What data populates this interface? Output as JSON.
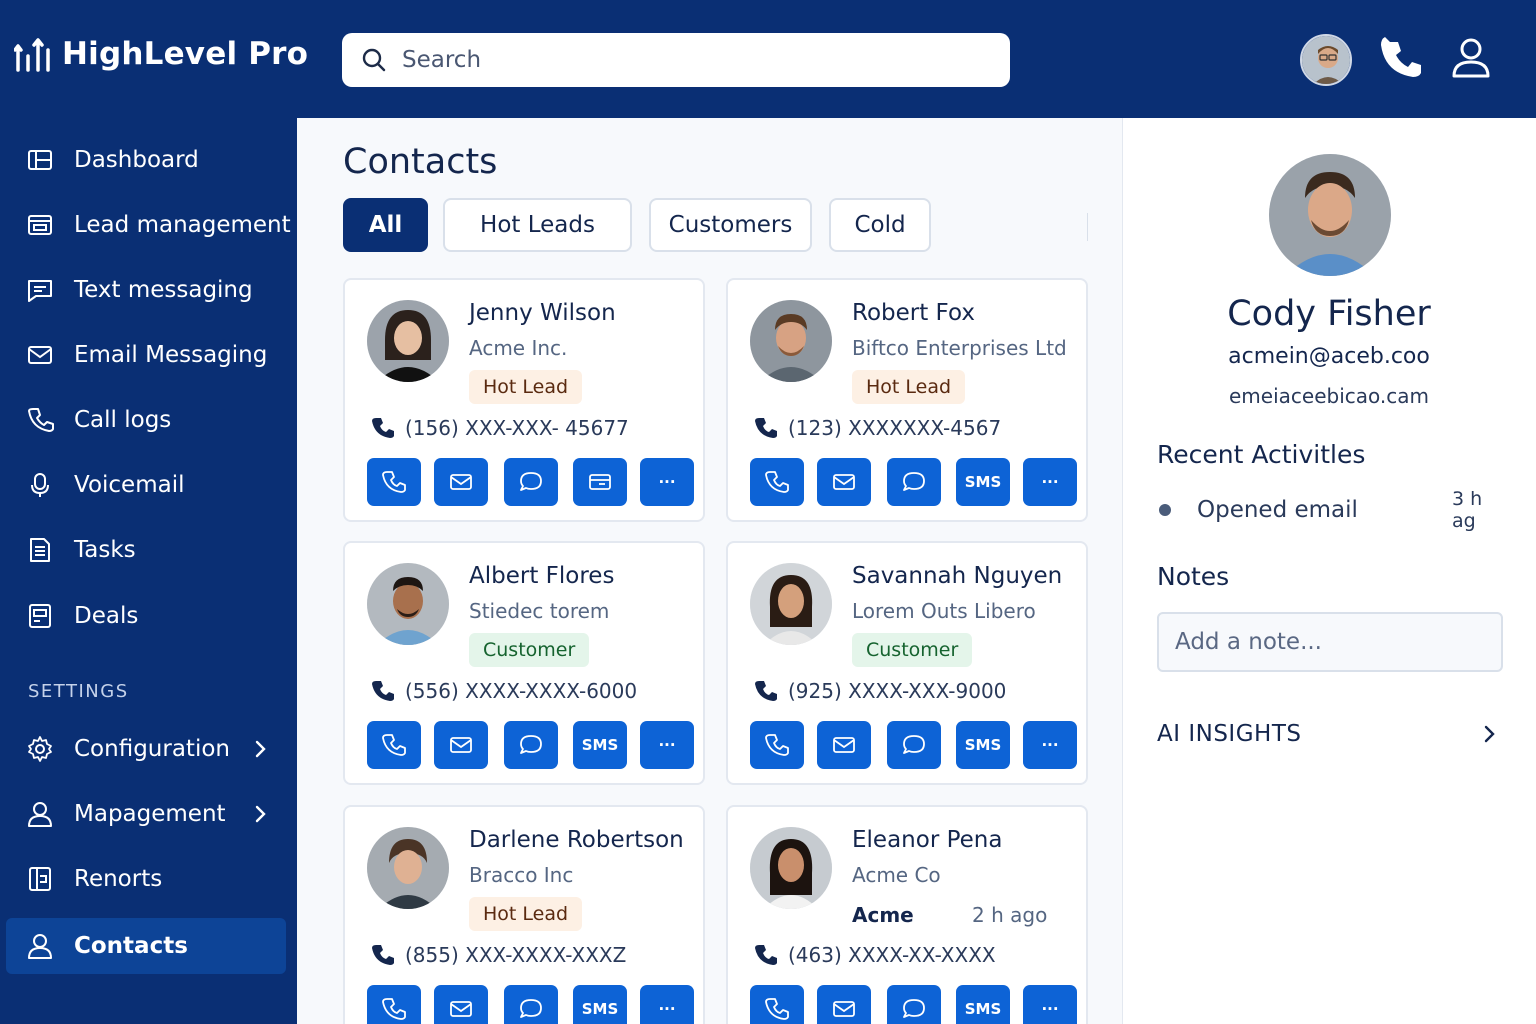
{
  "app": {
    "name": "HighLevel Pro"
  },
  "search": {
    "placeholder": "Search"
  },
  "sidebar": {
    "items": [
      {
        "label": "Dashboard",
        "icon": "dashboard-icon"
      },
      {
        "label": "Lead management",
        "icon": "lead-icon"
      },
      {
        "label": "Text messaging",
        "icon": "message-icon"
      },
      {
        "label": "Email Messaging",
        "icon": "mail-icon"
      },
      {
        "label": "Call logs",
        "icon": "phone-icon"
      },
      {
        "label": "Voicemail",
        "icon": "mic-icon"
      },
      {
        "label": "Tasks",
        "icon": "tasks-icon"
      },
      {
        "label": "Deals",
        "icon": "deals-icon"
      }
    ],
    "settings_label": "SETTINGS",
    "settings_items": [
      {
        "label": "Configuration",
        "icon": "gear-icon"
      },
      {
        "label": "Mapagement",
        "icon": "user-icon"
      },
      {
        "label": "Renorts",
        "icon": "reports-icon"
      },
      {
        "label": "Contacts",
        "icon": "user-icon",
        "active": true
      }
    ]
  },
  "main": {
    "title": "Contacts",
    "tabs": [
      {
        "label": "All",
        "active": true
      },
      {
        "label": "Hot Leads"
      },
      {
        "label": "Customers"
      },
      {
        "label": "Cold"
      }
    ],
    "contacts": [
      {
        "name": "Jenny Wilson",
        "company": "Acme Inc.",
        "status": "Hot Lead",
        "phone": "(156) XXX-XXX- 45677",
        "actions": [
          "call",
          "email",
          "chat",
          "card",
          "more"
        ]
      },
      {
        "name": "Robert Fox",
        "company": "Biftco Enterprises Ltd",
        "status": "Hot Lead",
        "phone": "(123) XXXXXXX-4567",
        "actions": [
          "call",
          "email",
          "chat",
          "SMS",
          "more"
        ]
      },
      {
        "name": "Albert Flores",
        "company": "Stiedec torem",
        "status": "Customer",
        "phone": "(556) XXXX-XXXX-6000",
        "actions": [
          "call",
          "email",
          "chat",
          "SMS",
          "more"
        ]
      },
      {
        "name": "Savannah Nguyen",
        "company": "Lorem Outs Libero",
        "status": "Customer",
        "phone": "(925) XXXX-XXX-9000",
        "actions": [
          "call",
          "email",
          "chat",
          "SMS",
          "more"
        ]
      },
      {
        "name": "Darlene Robertson",
        "company": "Bracco Inc",
        "status": "Hot Lead",
        "phone": "(855) XXX-XXXX-XXXZ",
        "actions": [
          "call",
          "email",
          "chat",
          "SMS",
          "more"
        ]
      },
      {
        "name": "Eleanor Pena",
        "company": "Acme Co",
        "status": "Acme",
        "status_time": "2 h ago",
        "phone": "(463) XXXX-XX-XXXX",
        "actions": [
          "call",
          "email",
          "chat",
          "SMS",
          "more"
        ]
      }
    ],
    "sms_label": "SMS",
    "more_label": "···"
  },
  "profile": {
    "name": "Cody Fisher",
    "email": "acmein@aceb.coo",
    "email_secondary": "emeiaceebicao.cam",
    "recent_title": "Recent Activitles",
    "activities": [
      {
        "label": "Opened email",
        "time": "3 h ag"
      }
    ],
    "notes_title": "Notes",
    "note_placeholder": "Add a note...",
    "ai_label": "AI INSIGHTS"
  },
  "colors": {
    "navy": "#0a2f74",
    "active_nav": "#0d4497",
    "action_blue": "#0d63d6",
    "hot_badge_bg": "#fdf0e4",
    "customer_badge_bg": "#e4f5ea"
  }
}
